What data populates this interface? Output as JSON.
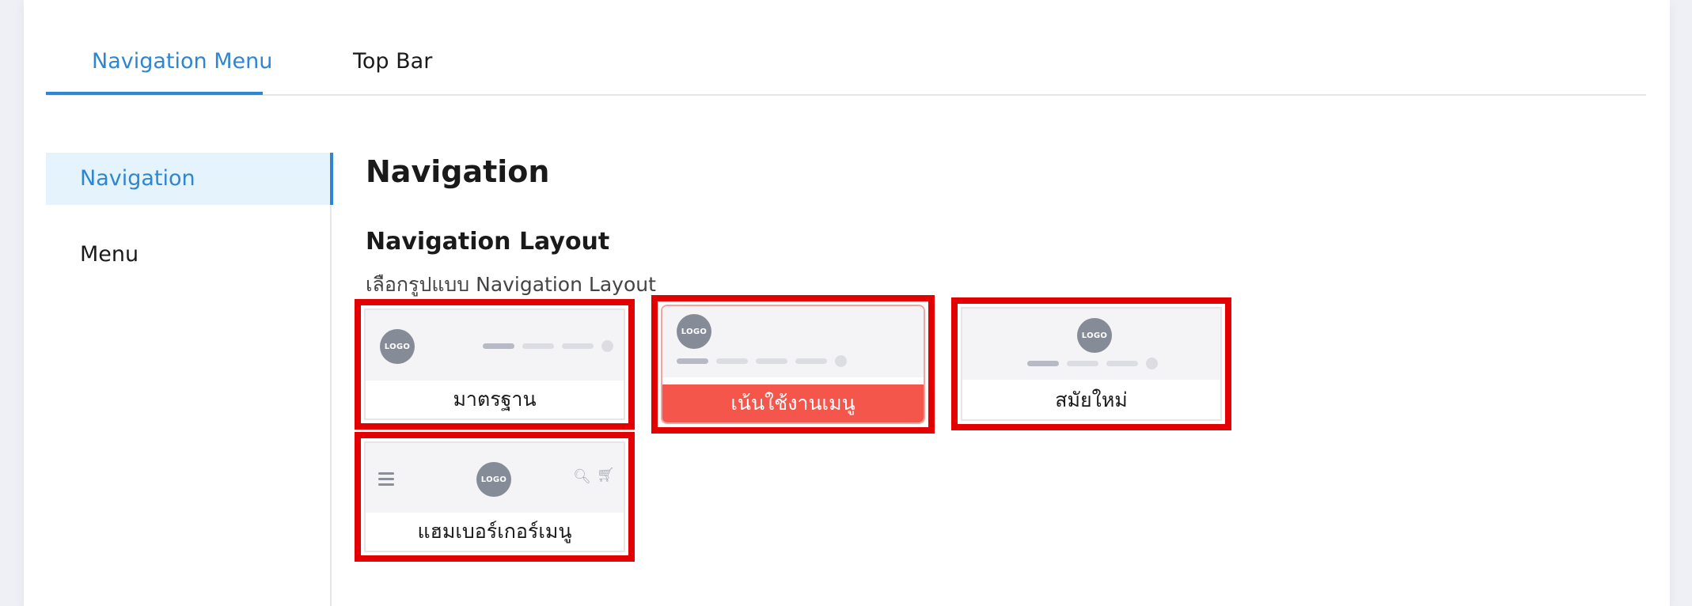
{
  "tabs": [
    {
      "label": "Navigation Menu",
      "active": true
    },
    {
      "label": "Top Bar",
      "active": false
    }
  ],
  "sidebar": {
    "items": [
      {
        "label": "Navigation",
        "active": true
      },
      {
        "label": "Menu",
        "active": false
      }
    ]
  },
  "content": {
    "title": "Navigation",
    "section_title": "Navigation Layout",
    "section_subtitle": "เลือกรูปแบบ Navigation Layout",
    "logo_text": "LOGO",
    "layouts": [
      {
        "label": "มาตรฐาน",
        "selected": false
      },
      {
        "label": "เน้นใช้งานเมนู",
        "selected": true
      },
      {
        "label": "สมัยใหม่",
        "selected": false
      },
      {
        "label": "แฮมเบอร์เกอร์เมนู",
        "selected": false
      }
    ]
  },
  "colors": {
    "accent": "#2f86d0",
    "selected_card": "#f5564c",
    "highlight_border": "#e20000"
  },
  "icons": [
    "hamburger-icon",
    "search-icon",
    "cart-icon"
  ]
}
